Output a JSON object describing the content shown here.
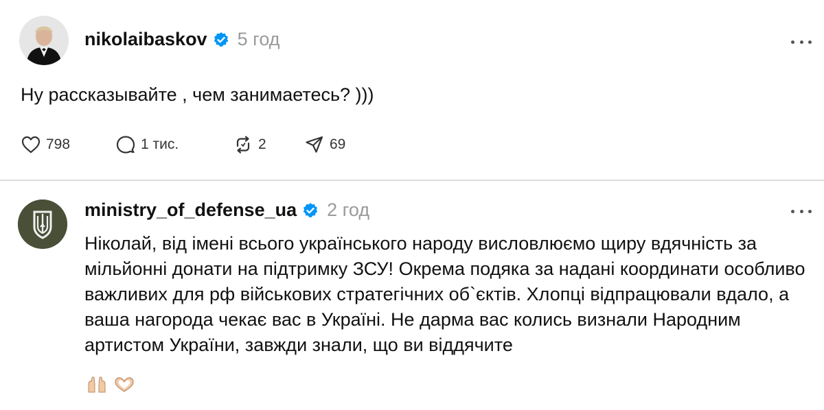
{
  "post1": {
    "username": "nikolaibaskov",
    "time": "5 год",
    "text": "Ну рассказывайте , чем занимаетесь? )))",
    "likes": "798",
    "replies": "1 тис.",
    "reposts": "2",
    "shares": "69"
  },
  "post2": {
    "username": "ministry_of_defense_ua",
    "time": "2 год",
    "text": "Ніколай, від імені всього українського народу висловлюємо щиру вдячність за мільйонні донати на підтримку ЗСУ! Окрема подяка за надані координати особливо важливих для рф військових стратегічних об`єктів. Хлопці відпрацювали вдало, а ваша нагорода чекає вас в Україні. Не дарма вас колись визнали Народним артистом України, завжди знали, що ви віддячите",
    "emoji": [
      "🙌",
      "🫶"
    ]
  },
  "colors": {
    "verified": "#0095f6",
    "time": "#9a9a9a",
    "divider": "#dcdcdc",
    "mod_avatar": "#4a4f38"
  },
  "icons": [
    "heart-icon",
    "comment-icon",
    "repost-icon",
    "share-icon",
    "more-icon",
    "verified-icon"
  ]
}
